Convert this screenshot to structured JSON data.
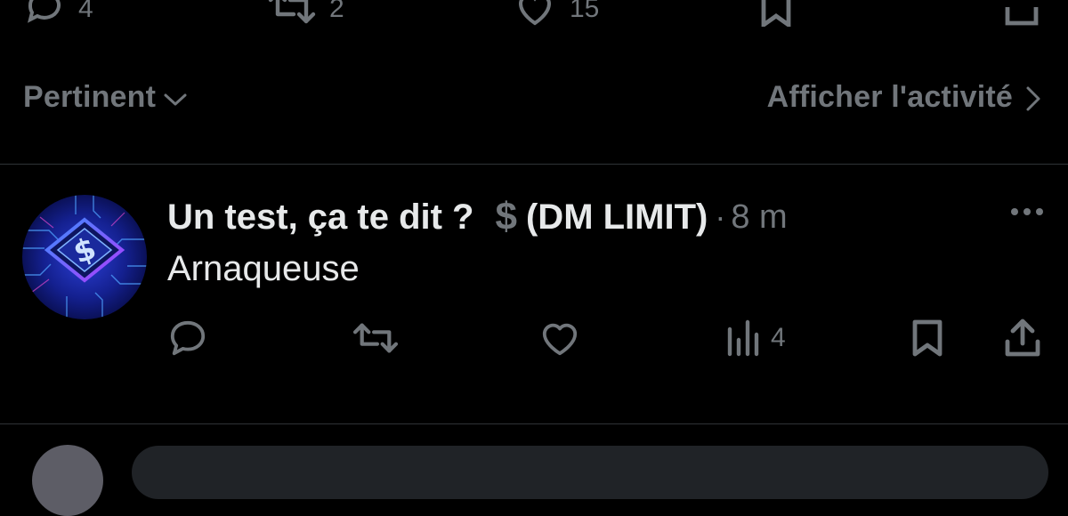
{
  "prev_post_actions": {
    "replies_count": "4",
    "reposts_count": "2",
    "likes_count": "15"
  },
  "sort": {
    "label": "Pertinent"
  },
  "activity": {
    "label": "Afficher l'activité"
  },
  "reply": {
    "display_name": "Un test, ça te dit ?",
    "dollar_symbol": "$",
    "display_name_suffix": "(DM LIMIT)",
    "separator": "·",
    "time": "8 m",
    "text": "Arnaqueuse",
    "views_count": "4"
  },
  "colors": {
    "background": "#000000",
    "text_primary": "#e7e9ea",
    "text_secondary": "#71767b",
    "divider": "#2f3336"
  },
  "icons": [
    "reply-icon",
    "repost-icon",
    "like-icon",
    "views-icon",
    "bookmark-icon",
    "share-icon",
    "more-icon",
    "chevron-down-icon",
    "chevron-right-icon"
  ]
}
